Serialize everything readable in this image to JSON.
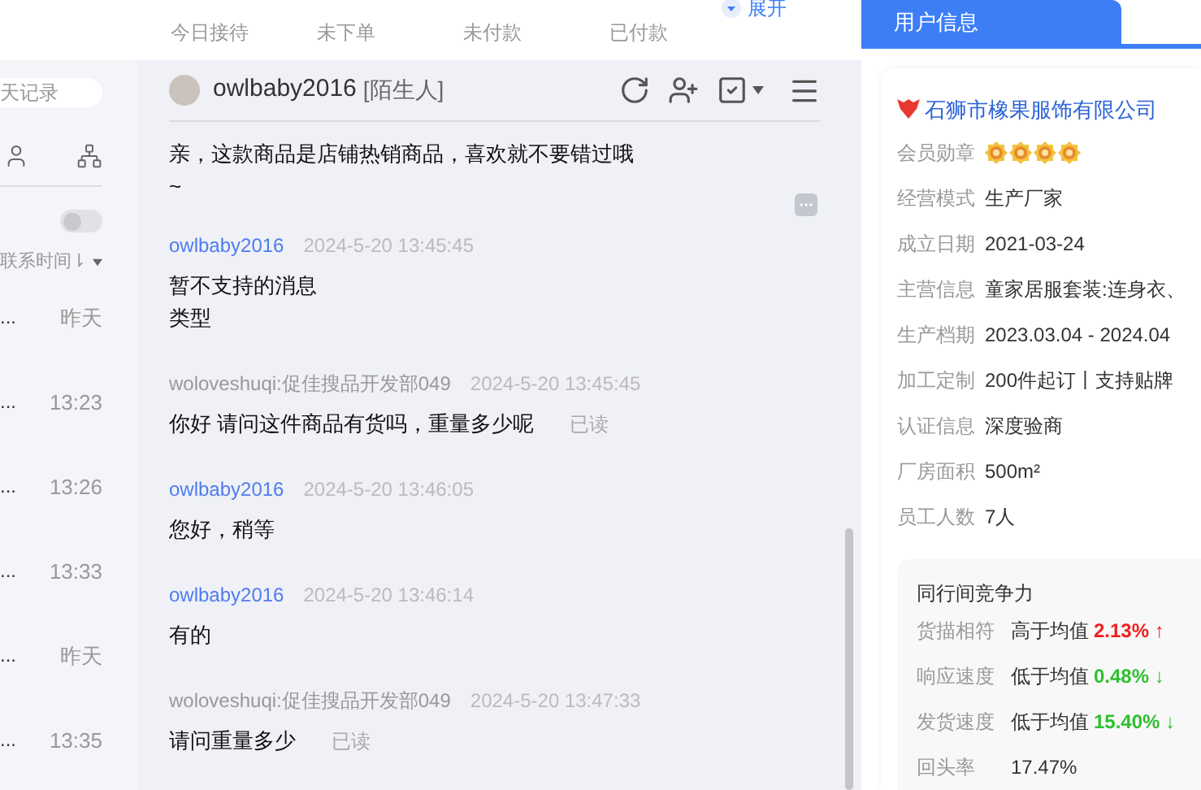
{
  "stats_tabs": [
    {
      "label": "今日接待"
    },
    {
      "label": "未下单"
    },
    {
      "label": "未付款"
    },
    {
      "label": "已付款"
    }
  ],
  "expand_link": "展开",
  "left_panel": {
    "search": {
      "placeholder": "天记录"
    },
    "toggle": {
      "on": false
    },
    "sort_label": "联系时间⇂",
    "conversations": [
      {
        "preview": "...",
        "time": "昨天"
      },
      {
        "preview": "...",
        "time": "13:23"
      },
      {
        "preview": "...",
        "time": "13:26"
      },
      {
        "preview": "...",
        "time": "13:33"
      },
      {
        "preview": "...",
        "time": "昨天"
      },
      {
        "preview": "...",
        "time": "13:35"
      }
    ]
  },
  "chat": {
    "contact": {
      "name": "owlbaby2016",
      "tag": "[陌生人]"
    },
    "messages": [
      {
        "kind": "agent",
        "text": "亲，这款商品是店铺热销商品，喜欢就不要错过哦~",
        "more": true
      },
      {
        "kind": "customer",
        "sender": "owlbaby2016",
        "time": "2024-5-20 13:45:45",
        "text": "暂不支持的消息类型"
      },
      {
        "kind": "agent",
        "sender": "woloveshuqi:促佳搜品开发部049",
        "time": "2024-5-20 13:45:45",
        "text": "你好 请问这件商品有货吗，重量多少呢",
        "status": "已读"
      },
      {
        "kind": "customer",
        "sender": "owlbaby2016",
        "time": "2024-5-20 13:46:05",
        "text": "您好，稍等"
      },
      {
        "kind": "customer",
        "sender": "owlbaby2016",
        "time": "2024-5-20 13:46:14",
        "text": "有的"
      },
      {
        "kind": "agent",
        "sender": "woloveshuqi:促佳搜品开发部049",
        "time": "2024-5-20 13:47:33",
        "text": "请问重量多少",
        "status": "已读"
      }
    ]
  },
  "right_panel": {
    "tab": {
      "label": "用户信息",
      "selected": true
    },
    "company": "石狮市橡果服饰有限公司",
    "info": [
      {
        "kind": "badges",
        "label": "会员勋章",
        "stars": 4
      },
      {
        "kind": "text",
        "label": "经营模式",
        "value": "生产厂家"
      },
      {
        "kind": "text",
        "label": "成立日期",
        "value": "2021-03-24"
      },
      {
        "kind": "text",
        "label": "主营信息",
        "value": "童家居服套装:连身衣、"
      },
      {
        "kind": "text",
        "label": "生产档期",
        "value": "2023.03.04 - 2024.04"
      },
      {
        "kind": "text",
        "label": "加工定制",
        "value": "200件起订丨支持贴牌"
      },
      {
        "kind": "text",
        "label": "认证信息",
        "value": "深度验商"
      },
      {
        "kind": "text",
        "label": "厂房面积",
        "value": "500m²"
      },
      {
        "kind": "text",
        "label": "员工人数",
        "value": "7人"
      }
    ],
    "competitiveness": {
      "title": "同行间竞争力",
      "rows": [
        {
          "label": "货描相符",
          "comparison": "高于均值",
          "percent": "2.13% ↑",
          "color": "#f21d1d"
        },
        {
          "label": "响应速度",
          "comparison": "低于均值",
          "percent": "0.48% ↓",
          "color": "#2fc12f"
        },
        {
          "label": "发货速度",
          "comparison": "低于均值",
          "percent": "15.40% ↓",
          "color": "#2fc12f"
        },
        {
          "label": "回头率",
          "comparison": "17.47%"
        }
      ]
    }
  }
}
